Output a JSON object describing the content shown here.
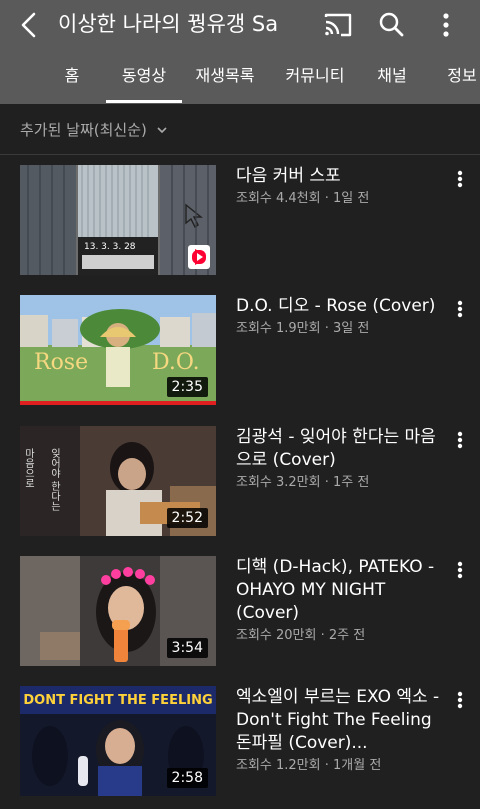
{
  "header": {
    "title": "이상한 나라의 꿩유갱 Sa",
    "icons": [
      "back-arrow-icon",
      "cast-icon",
      "search-icon",
      "more-vert-icon"
    ]
  },
  "tabs": [
    {
      "label": "홈"
    },
    {
      "label": "동영상",
      "selected": true
    },
    {
      "label": "재생목록"
    },
    {
      "label": "커뮤니티"
    },
    {
      "label": "채널"
    },
    {
      "label": "정보"
    }
  ],
  "filter": {
    "label": "추가된 날짜(최신순)"
  },
  "videos": [
    {
      "title": "다음 커버 스포",
      "meta": "조회수 4.4천회 · 1일 전",
      "duration": "",
      "is_short": true
    },
    {
      "title": "D.O. 디오 - Rose (Cover)",
      "meta": "조회수 1.9만회 · 3일 전",
      "duration": "2:35",
      "watched": 1.0
    },
    {
      "title": "김광석 - 잊어야 한다는 마음으로 (Cover)",
      "meta": "조회수 3.2만회 · 1주 전",
      "duration": "2:52",
      "watched": 0
    },
    {
      "title": "디핵 (D-Hack), PATEKO - OHAYO MY NIGHT (Cover)",
      "meta": "조회수 20만회 · 2주 전",
      "duration": "3:54",
      "watched": 0
    },
    {
      "title": "엑소엘이 부르는 EXO 엑소 - Don't Fight The Feeling 돈파필 (Cover)...",
      "meta": "조회수 1.2만회 · 1개월 전",
      "duration": "2:58",
      "watched": 0
    }
  ],
  "thumb_text": {
    "v1_counter": "13. 3. 3. 28",
    "v2_left": "Rose",
    "v2_right": "D.O.",
    "v3_vertical_1": "마음으로",
    "v3_vertical_2": "잊어야 한다는",
    "v5_banner": "DONT FIGHT THE FEELING"
  },
  "colors": {
    "background": "#202020",
    "header": "#5a5a5a",
    "meta_text": "#aaaaaa",
    "progress_red": "#e02020",
    "shorts_red": "#ff0033"
  }
}
